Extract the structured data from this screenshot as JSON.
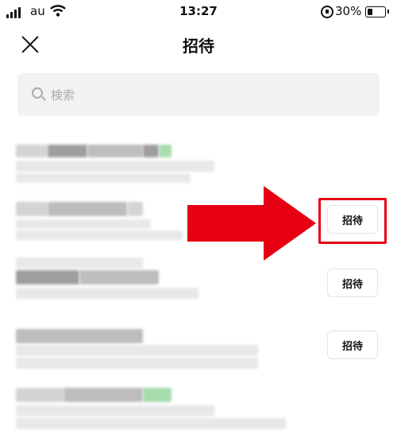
{
  "status_bar": {
    "carrier": "au",
    "time": "13:27",
    "battery_percent": "30%",
    "battery_level": 0.3
  },
  "header": {
    "title": "招待"
  },
  "search": {
    "placeholder": "検索"
  },
  "list": {
    "invite_label": "招待"
  },
  "annotation": {
    "arrow_color": "#e60012",
    "highlight_color": "#e60012"
  }
}
